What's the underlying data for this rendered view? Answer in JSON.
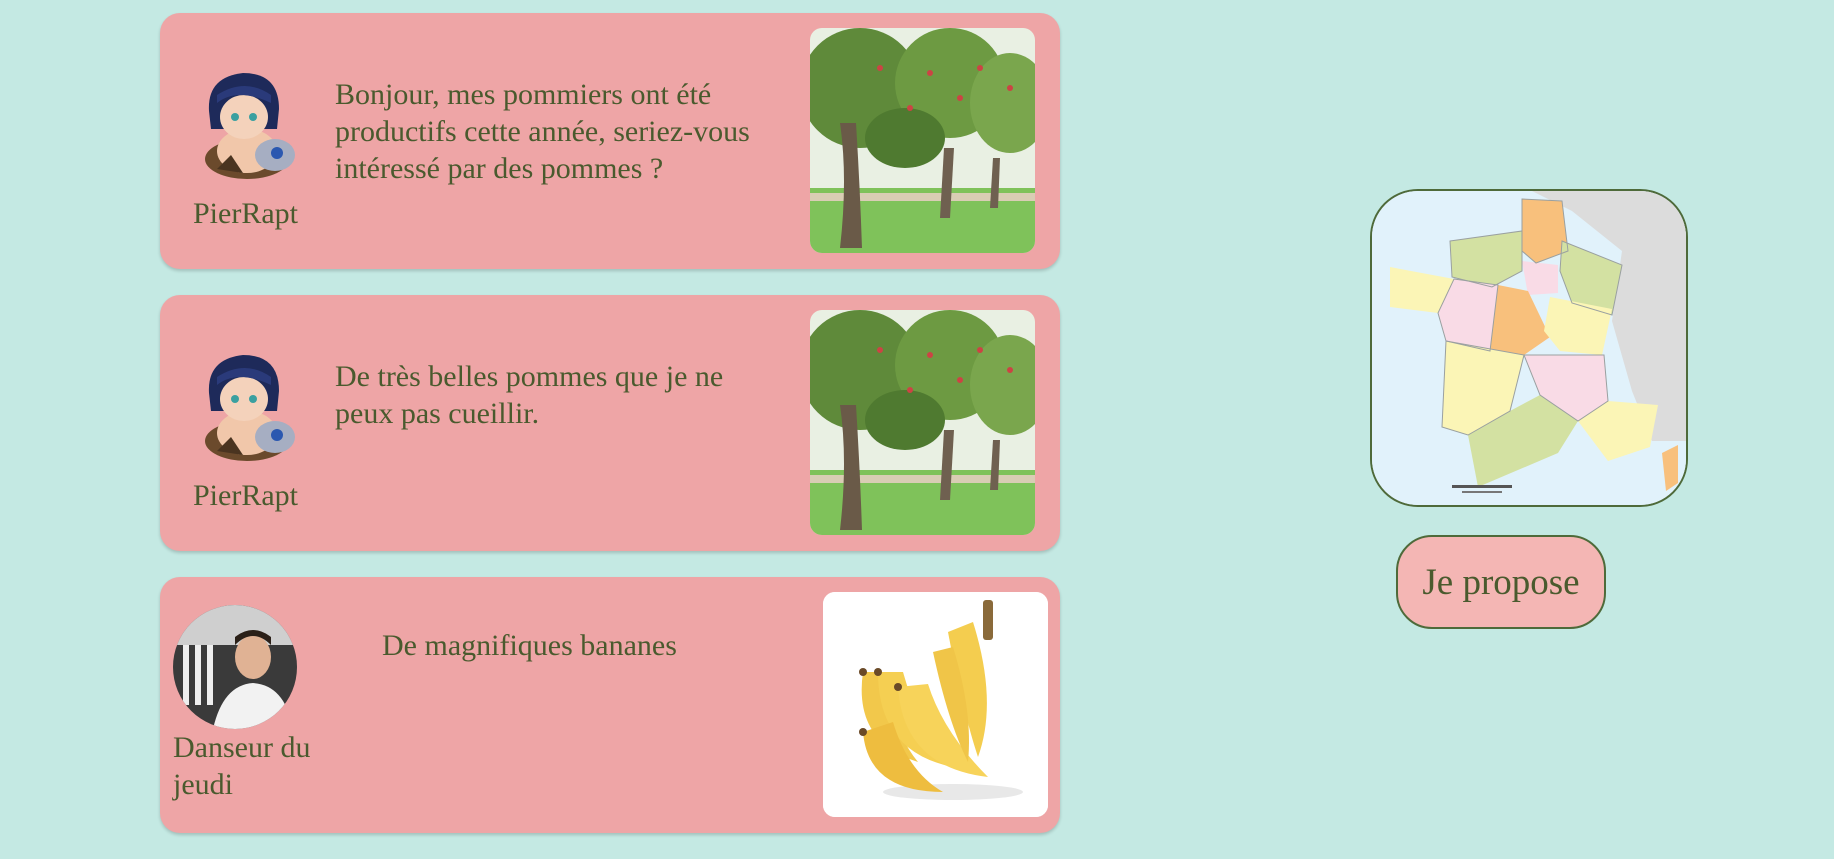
{
  "posts": [
    {
      "author": "PierRapt",
      "message": "Bonjour, mes pommiers ont été productifs cette année, seriez-vous intéressé par des pommes ?",
      "avatar_icon": "anime-character-avatar",
      "photo_icon": "apple-orchard-photo"
    },
    {
      "author": "PierRapt",
      "message": "De très belles pommes que je ne peux pas cueillir.",
      "avatar_icon": "anime-character-avatar",
      "photo_icon": "apple-orchard-photo"
    },
    {
      "author": "Danseur du jeudi",
      "message": "De magnifiques bananes",
      "avatar_icon": "person-photo-avatar",
      "photo_icon": "bananas-photo"
    }
  ],
  "side": {
    "map_icon": "france-regions-map",
    "propose_label": "Je propose"
  },
  "colors": {
    "background": "#c4e9e3",
    "card": "#eea5a6",
    "text": "#4a5a2e",
    "button": "#f4b6b4"
  }
}
